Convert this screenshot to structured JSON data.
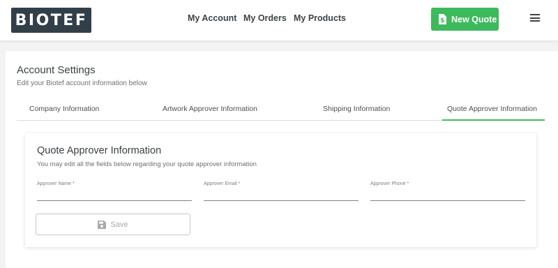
{
  "header": {
    "logo_text": "BIOTEF",
    "nav": [
      "My Account",
      "My Orders",
      "My Products"
    ],
    "new_quote_label": "New Quote",
    "menu_icon": "hamburger-menu-icon"
  },
  "page": {
    "title": "Account Settings",
    "subtitle": "Edit your Biotef account information below"
  },
  "tabs": [
    {
      "label": "Company Information",
      "active": false
    },
    {
      "label": "Artwork Approver Information",
      "active": false
    },
    {
      "label": "Shipping Information",
      "active": false
    },
    {
      "label": "Quote Approver Information",
      "active": true
    }
  ],
  "form": {
    "title": "Quote Approver Information",
    "subtitle": "You may edit all the fields below regarding your quote approver information",
    "fields": [
      {
        "label": "Approver Name *",
        "value": ""
      },
      {
        "label": "Approver Email *",
        "value": ""
      },
      {
        "label": "Approver Phone *",
        "value": ""
      }
    ],
    "save_label": "Save"
  },
  "colors": {
    "accent": "#3dba5c",
    "logo_bg": "#333f48",
    "background": "#f3f3f3"
  }
}
